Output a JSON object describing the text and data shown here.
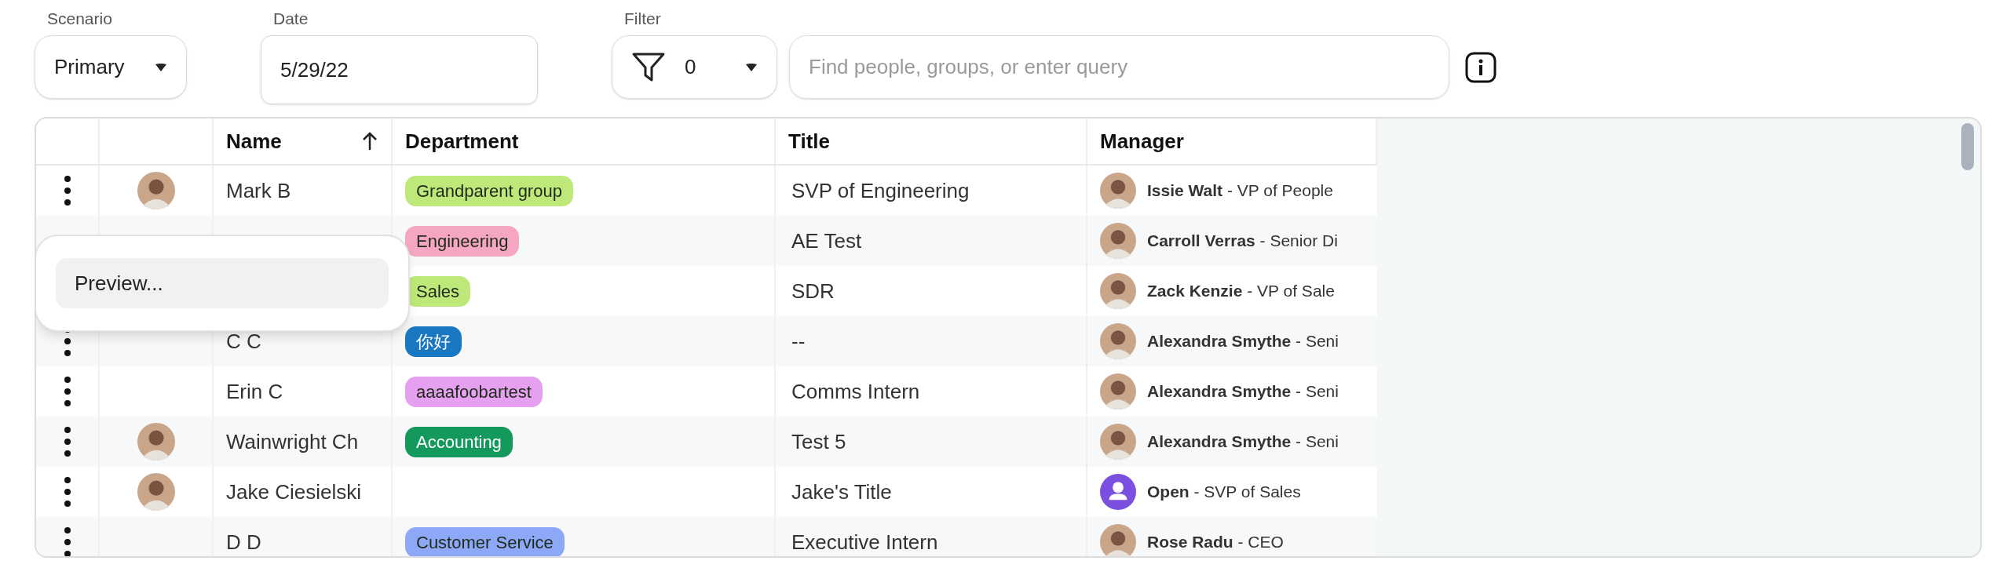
{
  "controls": {
    "scenario": {
      "label": "Scenario",
      "value": "Primary"
    },
    "date": {
      "label": "Date",
      "value": "5/29/22"
    },
    "filter": {
      "label": "Filter",
      "count": "0"
    },
    "search": {
      "placeholder": "Find people, groups, or enter query"
    }
  },
  "table": {
    "columns": [
      {
        "label": "Name",
        "sorted": true
      },
      {
        "label": "Department",
        "sorted": false
      },
      {
        "label": "Title",
        "sorted": false
      },
      {
        "label": "Manager",
        "sorted": false
      }
    ],
    "rows": [
      {
        "menu": true,
        "avatar": true,
        "name": "Mark B",
        "department": {
          "label": "Grandparent group",
          "color": "#bfe87a"
        },
        "title": "SVP of Engineering",
        "manager": {
          "kind": "photo",
          "text": "**Issie Walt** - VP of People"
        }
      },
      {
        "menu": false,
        "avatar": false,
        "department": {
          "label": "Engineering",
          "color": "#f5a6c2"
        },
        "title": "AE Test",
        "manager": {
          "kind": "photo",
          "text": "**Carroll Verras** - Senior Di"
        }
      },
      {
        "menu": false,
        "avatar": false,
        "department": {
          "label": "Sales",
          "color": "#bfe87a"
        },
        "title": "SDR",
        "manager": {
          "kind": "photo",
          "text": "**Zack Kenzie** - VP of Sale"
        }
      },
      {
        "menu": true,
        "avatar": false,
        "name": "C C",
        "department": {
          "label": "你好",
          "color": "#1a78c2"
        },
        "title": "--",
        "manager": {
          "kind": "photo",
          "text": "**Alexandra Smythe** - Seni"
        }
      },
      {
        "menu": true,
        "avatar": false,
        "name": "Erin C",
        "department": {
          "label": "aaaafoobartest",
          "color": "#e6a0f0"
        },
        "title": "Comms Intern",
        "manager": {
          "kind": "photo",
          "text": "**Alexandra Smythe** - Seni"
        }
      },
      {
        "menu": true,
        "avatar": true,
        "name": "Wainwright Ch",
        "department": {
          "label": "Accounting",
          "color": "#14995c"
        },
        "title": "Test 5",
        "manager": {
          "kind": "photo",
          "text": "**Alexandra Smythe** - Seni"
        }
      },
      {
        "menu": true,
        "avatar": true,
        "name": "Jake Ciesielski",
        "title": "Jake's Title",
        "manager": {
          "kind": "open",
          "text": "**Open** - SVP of Sales"
        }
      },
      {
        "menu": true,
        "avatar": false,
        "name": "D D",
        "department": {
          "label": "Customer Service",
          "color": "#8ea8f8"
        },
        "title": "Executive Intern",
        "manager": {
          "kind": "photo",
          "text": "**Rose Radu** - CEO"
        }
      }
    ]
  },
  "popup_menu": {
    "items": [
      {
        "label": "Preview...",
        "selected": true
      }
    ]
  }
}
